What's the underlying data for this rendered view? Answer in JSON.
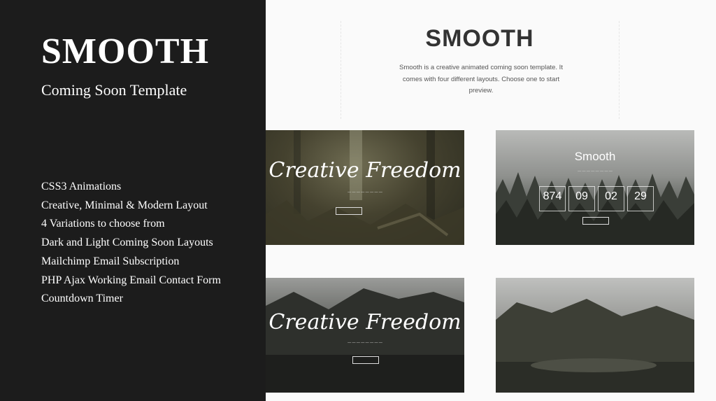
{
  "left": {
    "brand": "SMOOTH",
    "tagline": "Coming Soon Template",
    "features": [
      "CSS3 Animations",
      "Creative, Minimal & Modern Layout",
      "4 Variations to choose from",
      "Dark and Light Coming Soon Layouts",
      "Mailchimp Email Subscription",
      "PHP Ajax Working Email Contact Form",
      "Countdown Timer"
    ]
  },
  "right": {
    "title": "SMOOTH",
    "description": "Smooth is a creative animated coming soon template. It comes with four different layouts. Choose one to start preview."
  },
  "previews": {
    "p1_heading": "Creative Freedom",
    "p2_heading": "Smooth",
    "p2_countdown": [
      {
        "value": "874"
      },
      {
        "value": "09"
      },
      {
        "value": "02"
      },
      {
        "value": "29"
      }
    ],
    "p3_heading": "Creative Freedom"
  },
  "colors": {
    "left_panel": "#1c1c1c",
    "right_bg": "#fafafa",
    "title": "#333333"
  }
}
